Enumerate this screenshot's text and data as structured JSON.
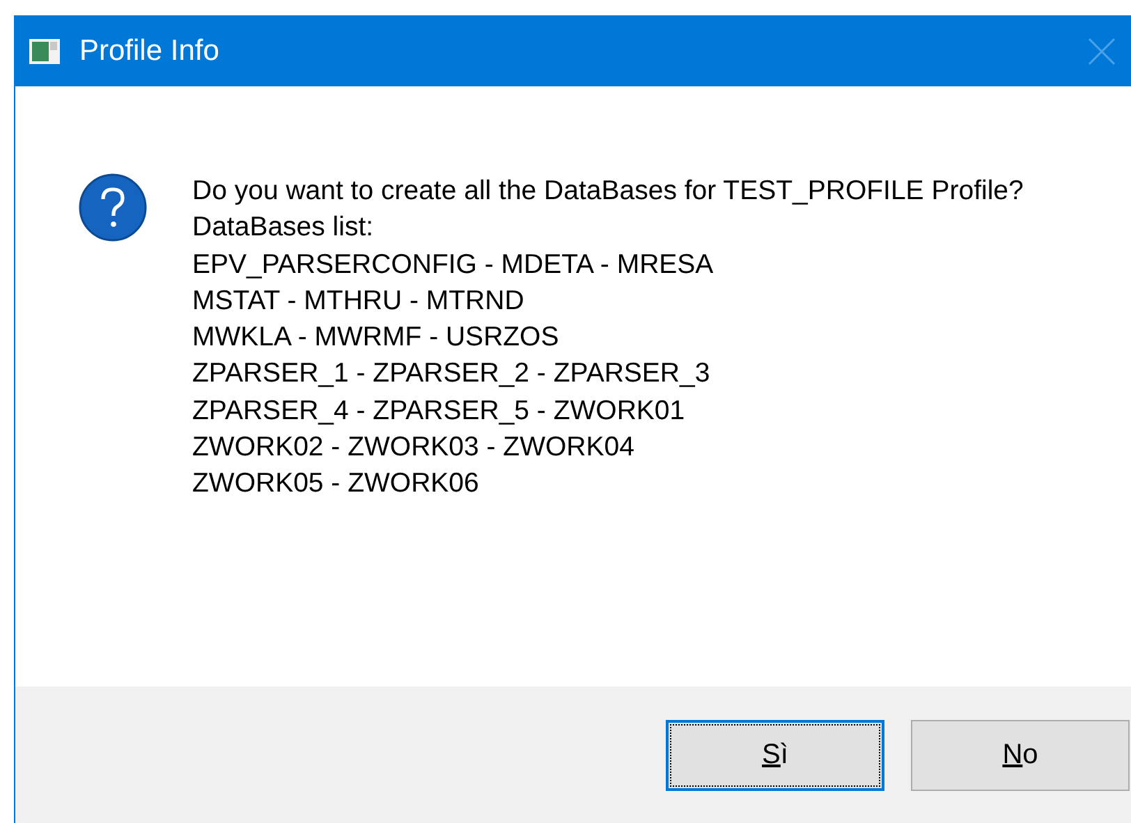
{
  "window": {
    "title": "Profile Info",
    "close_button": {
      "disabled": true
    }
  },
  "message": {
    "lines": [
      "Do you want to create all the DataBases for TEST_PROFILE Profile?",
      "DataBases list:",
      "EPV_PARSERCONFIG - MDETA - MRESA",
      "MSTAT - MTHRU - MTRND",
      "MWKLA - MWRMF - USRZOS",
      "ZPARSER_1 - ZPARSER_2 - ZPARSER_3",
      "ZPARSER_4 - ZPARSER_5 - ZWORK01",
      "ZWORK02 - ZWORK03 - ZWORK04",
      "ZWORK05 - ZWORK06"
    ]
  },
  "buttons": [
    {
      "label": "Sì",
      "mnemonic": true,
      "focused": true
    },
    {
      "label": "No",
      "mnemonic": true,
      "focused": false
    }
  ]
}
